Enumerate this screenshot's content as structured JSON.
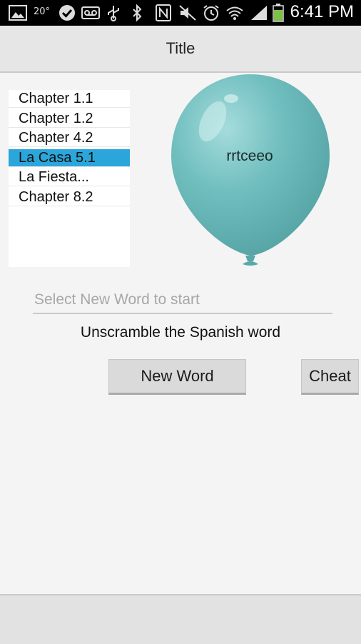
{
  "status_bar": {
    "temperature": "20°",
    "time": "6:41 PM",
    "icons": [
      "gallery-icon",
      "check-circle-icon",
      "voicemail-icon",
      "usb-icon",
      "bluetooth-icon",
      "nfc-icon",
      "mute-icon",
      "alarm-icon",
      "wifi-icon",
      "signal-icon",
      "battery-icon"
    ]
  },
  "app_bar": {
    "title": "Title"
  },
  "chapters": {
    "items": [
      {
        "label": "Chapter 1.1"
      },
      {
        "label": "Chapter 1.2"
      },
      {
        "label": "Chapter 4.2"
      },
      {
        "label": "La Casa 5.1"
      },
      {
        "label": "La Fiesta..."
      },
      {
        "label": "Chapter 8.2"
      }
    ],
    "selected_label": "La Casa 5.1"
  },
  "balloon": {
    "scrambled_word": "rrtceeo",
    "color": "#6fbcbd"
  },
  "input": {
    "placeholder": "Select New Word to start",
    "value": ""
  },
  "instruction": "Unscramble the Spanish word",
  "buttons": {
    "new_word": "New Word",
    "cheat": "Cheat"
  },
  "colors": {
    "selected_item": "#2aa6db",
    "background": "#f4f4f4"
  }
}
